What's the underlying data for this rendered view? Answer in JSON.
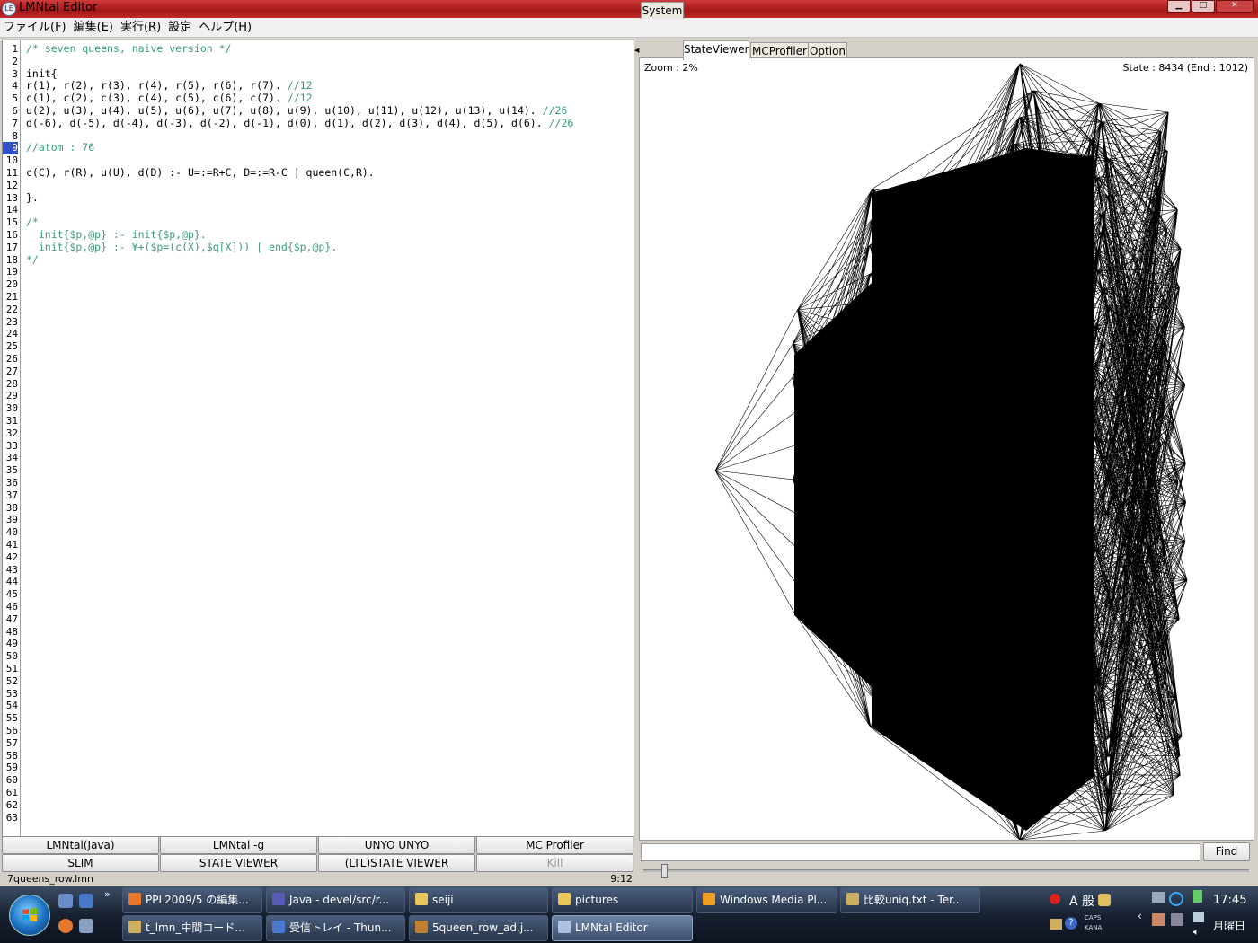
{
  "window": {
    "title": "LMNtal Editor",
    "icon_text": "LE"
  },
  "menu": [
    "ファイル(F)",
    "編集(E)",
    "実行(R)",
    "設定",
    "ヘルプ(H)"
  ],
  "editor": {
    "current_line": 9,
    "line_count": 63,
    "lines": [
      {
        "n": 1,
        "code": "",
        "comment": "/* seven queens, naive version */"
      },
      {
        "n": 3,
        "code": "init{",
        "comment": ""
      },
      {
        "n": 4,
        "code": "r(1), r(2), r(3), r(4), r(5), r(6), r(7). ",
        "comment": "//12"
      },
      {
        "n": 5,
        "code": "c(1), c(2), c(3), c(4), c(5), c(6), c(7). ",
        "comment": "//12"
      },
      {
        "n": 6,
        "code": "u(2), u(3), u(4), u(5), u(6), u(7), u(8), u(9), u(10), u(11), u(12), u(13), u(14). ",
        "comment": "//26"
      },
      {
        "n": 7,
        "code": "d(-6), d(-5), d(-4), d(-3), d(-2), d(-1), d(0), d(1), d(2), d(3), d(4), d(5), d(6). ",
        "comment": "//26"
      },
      {
        "n": 9,
        "code": "",
        "comment": "//atom : 76"
      },
      {
        "n": 11,
        "code": "c(C), r(R), u(U), d(D) :- U=:=R+C, D=:=R-C | queen(C,R).",
        "comment": ""
      },
      {
        "n": 13,
        "code": "}.",
        "comment": ""
      },
      {
        "n": 15,
        "code": "",
        "comment": "/*"
      },
      {
        "n": 16,
        "code": "",
        "comment": "  init{$p,@p} :- init{$p,@p}."
      },
      {
        "n": 17,
        "code": "",
        "comment": "  init{$p,@p} :- ¥+($p=(c(X),$q[X])) | end{$p,@p}."
      },
      {
        "n": 18,
        "code": "",
        "comment": "*/"
      }
    ]
  },
  "buttons": {
    "row1": [
      "LMNtal(Java)",
      "LMNtal -g",
      "UNYO UNYO",
      "MC Profiler"
    ],
    "row2": [
      "SLIM",
      "STATE VIEWER",
      "(LTL)STATE VIEWER",
      "Kill"
    ]
  },
  "status": {
    "filename": "7queens_row.lmn",
    "cursor": "9:12"
  },
  "right_panel": {
    "tabs": [
      "System",
      "StateViewer",
      "MCProfiler",
      "Option"
    ],
    "active_tab": "StateViewer",
    "zoom": "Zoom : 2%",
    "state_info": "State : 8434 (End : 1012)",
    "find_value": "",
    "find_label": "Find",
    "slider_level": 0.03
  },
  "taskbar": {
    "row1": [
      {
        "label": "PPL2009/5 の編集...",
        "icon": "firefox-icon",
        "color": "#e8762b"
      },
      {
        "label": "Java - devel/src/r...",
        "icon": "eclipse-icon",
        "color": "#5a5ab8"
      },
      {
        "label": "seiji",
        "icon": "folder-icon",
        "color": "#e8c85a"
      },
      {
        "label": "pictures",
        "icon": "folder-icon",
        "color": "#e8c85a"
      },
      {
        "label": "Windows Media Pl...",
        "icon": "media-player-icon",
        "color": "#f0a020"
      },
      {
        "label": "比較uniq.txt - Ter...",
        "icon": "terapad-icon",
        "color": "#d0b060"
      }
    ],
    "row2": [
      {
        "label": "t_lmn_中間コード...",
        "icon": "terapad-icon",
        "color": "#d0b060"
      },
      {
        "label": "受信トレイ - Thun...",
        "icon": "thunderbird-icon",
        "color": "#4a7ad0"
      },
      {
        "label": "5queen_row_ad.j...",
        "icon": "image-viewer-icon",
        "color": "#c08030"
      },
      {
        "label": "LMNtal Editor",
        "icon": "lmntal-icon",
        "color": "#b0c0e0"
      }
    ],
    "ime": "A 般",
    "caps": "CAPS",
    "kana": "KANA",
    "clock": "17:45",
    "day": "月曜日"
  }
}
